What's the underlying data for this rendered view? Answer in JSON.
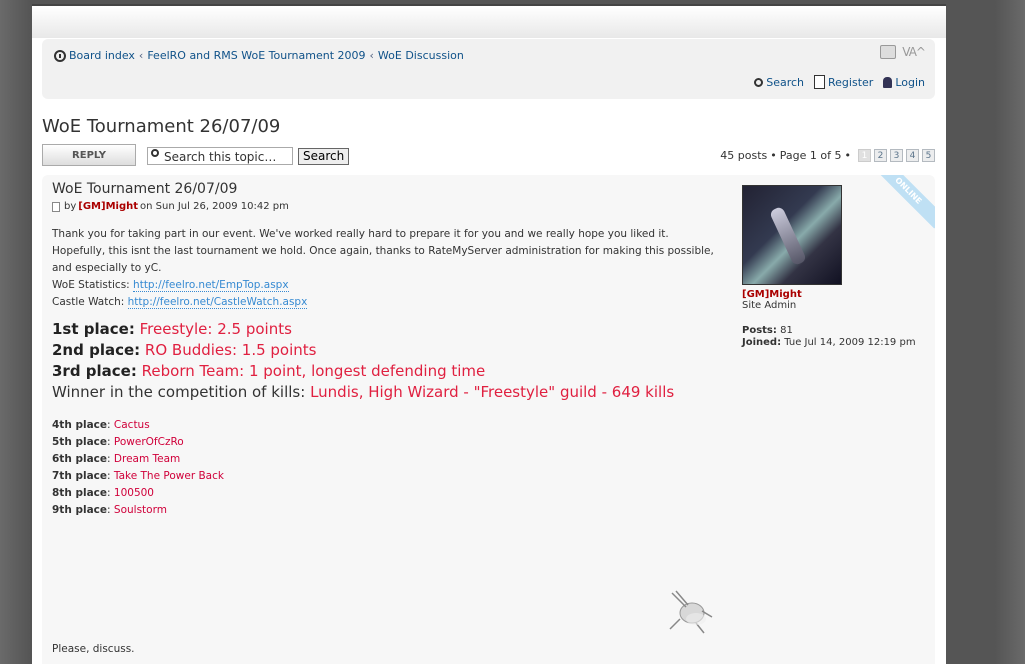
{
  "breadcrumbs": [
    "Board index",
    "FeelRO and RMS WoE Tournament 2009",
    "WoE Discussion"
  ],
  "breadcrumb_sep": "‹",
  "tools": {
    "print": "print-icon",
    "font": "VA^"
  },
  "userlinks": {
    "search": "Search",
    "register": "Register",
    "login": "Login"
  },
  "topic_title": "WoE Tournament 26/07/09",
  "actions": {
    "reply": "REPLY",
    "search_value": "Search this topic…",
    "search_button": "Search"
  },
  "pagination": {
    "posts": "45 posts",
    "page_text": "Page 1 of 5",
    "pages": [
      "1",
      "2",
      "3",
      "4",
      "5"
    ],
    "current": "1"
  },
  "post": {
    "title": "WoE Tournament 26/07/09",
    "by": "by",
    "author": "[GM]Might",
    "date": "on Sun Jul 26, 2009 10:42 pm",
    "intro": "Thank you for taking part in our event. We've worked really hard to prepare it for you and we really hope you liked it. Hopefully, this isnt the last tournament we hold. Once again, thanks to RateMyServer administration for making this possible, and especially to yC.",
    "woe_label": "WoE Statistics: ",
    "woe_link": "http://feelro.net/EmpTop.aspx",
    "castle_label": "Castle Watch: ",
    "castle_link": "http://feelro.net/CastleWatch.aspx",
    "big_places": [
      {
        "label": "1st place:",
        "value": "Freestyle: 2.5 points"
      },
      {
        "label": "2nd place:",
        "value": "RO Buddies: 1.5 points"
      },
      {
        "label": "3rd place:",
        "value": "Reborn Team: 1 point, longest defending time"
      },
      {
        "label": "Winner in the competition of kills:",
        "value": "Lundis, High Wizard - \"Freestyle\" guild - 649 kills"
      }
    ],
    "small_places": [
      {
        "label": "4th place",
        "value": "Cactus"
      },
      {
        "label": "5th place",
        "value": "PowerOfCzRo"
      },
      {
        "label": "6th place",
        "value": "Dream Team"
      },
      {
        "label": "7th place",
        "value": "Take The Power Back"
      },
      {
        "label": "8th place",
        "value": "100500"
      },
      {
        "label": "9th place",
        "value": "Soulstorm"
      }
    ],
    "closing": "Please, discuss."
  },
  "profile": {
    "name": "[GM]Might",
    "rank": "Site Admin",
    "posts_label": "Posts:",
    "posts": "81",
    "joined_label": "Joined:",
    "joined": "Tue Jul 14, 2009 12:19 pm",
    "status": "ONLINE"
  },
  "colors": {
    "link": "#105289",
    "author": "#aa0000",
    "highlight": "#e02040"
  }
}
